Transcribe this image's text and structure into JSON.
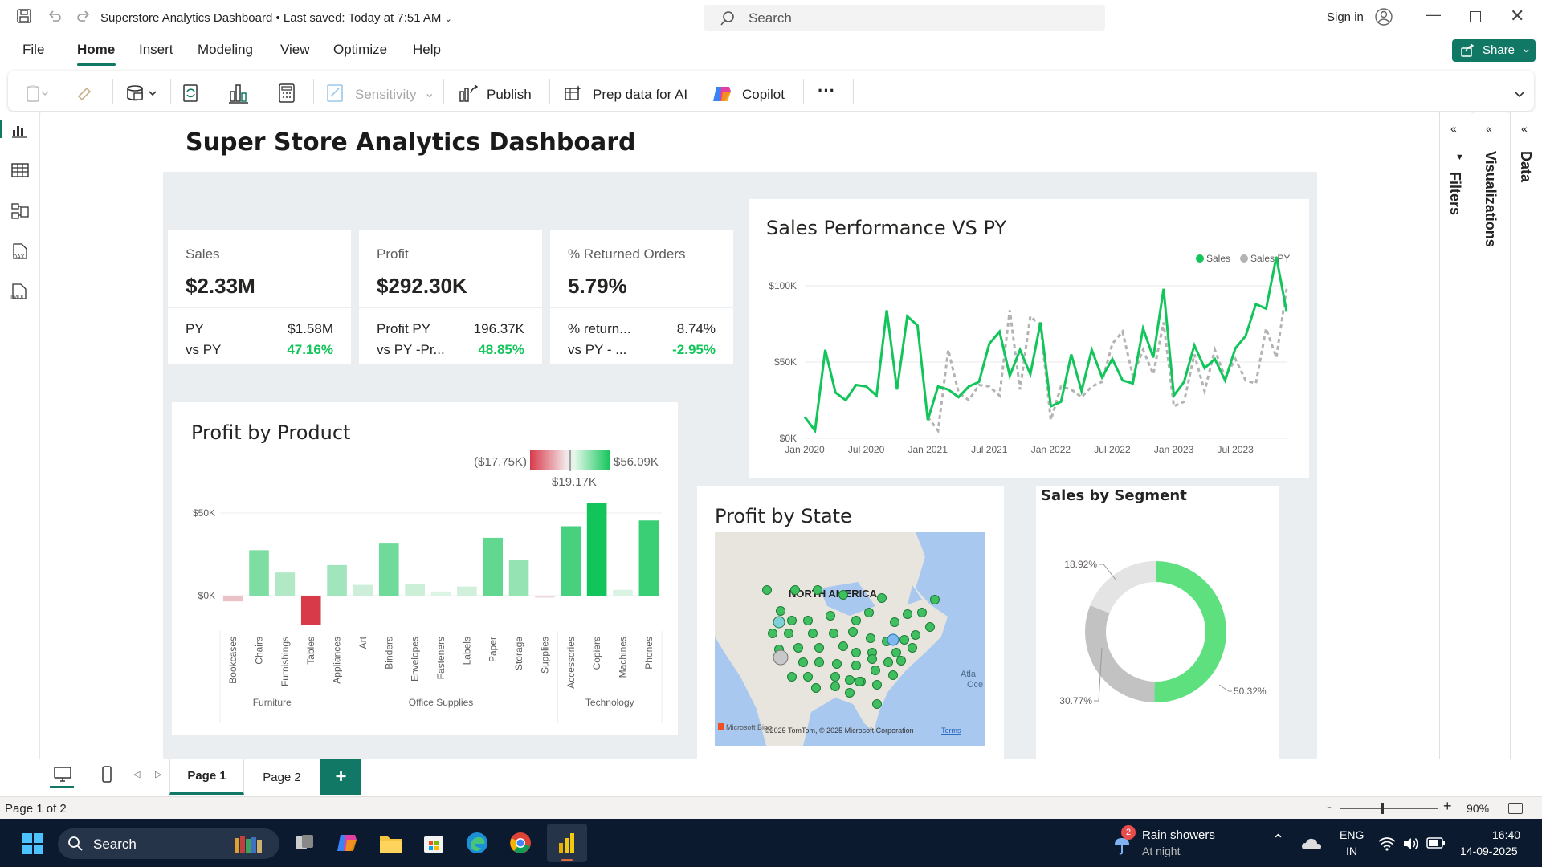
{
  "titlebar": {
    "doc_title": "Superstore Analytics Dashboard",
    "saved": "Last saved: Today at 7:51 AM",
    "search_placeholder": "Search",
    "sign_in": "Sign in"
  },
  "menu": [
    "File",
    "Home",
    "Insert",
    "Modeling",
    "View",
    "Optimize",
    "Help"
  ],
  "share_label": "Share",
  "ribbon": {
    "sensitivity": "Sensitivity",
    "publish": "Publish",
    "prep": "Prep data for AI",
    "copilot": "Copilot",
    "more": "···"
  },
  "report": {
    "title": "Super Store Analytics Dashboard",
    "kpis": [
      {
        "label": "Sales",
        "value": "$2.33M",
        "r1l": "PY",
        "r1v": "$1.58M",
        "r2l": "vs PY",
        "r2v": "47.16%"
      },
      {
        "label": "Profit",
        "value": "$292.30K",
        "r1l": "Profit PY",
        "r1v": "196.37K",
        "r2l": "vs PY -Pr...",
        "r2v": "48.85%"
      },
      {
        "label": "% Returned Orders",
        "value": "5.79%",
        "r1l": "% return...",
        "r1v": "8.74%",
        "r2l": "vs PY - ...",
        "r2v": "-2.95%"
      }
    ]
  },
  "line_chart_title": "Sales Performance VS PY",
  "bar_chart_title": "Profit by Product",
  "map_title": "Profit by State",
  "donut_title": "Sales by Segment",
  "gradient_legend": {
    "min": "($17.75K)",
    "max": "$56.09K",
    "mid": "$19.17K"
  },
  "map": {
    "label": "NORTH AMERICA",
    "attribution": "©2025 TomTom, © 2025 Microsoft Corporation",
    "terms": "Terms",
    "brand": "Microsoft Bing",
    "atlantic": "Atla\nOce"
  },
  "chart_data": [
    {
      "type": "line",
      "title": "Sales Performance VS PY",
      "legend": [
        "Sales",
        "Sales PY"
      ],
      "legend_position": "top-right",
      "x_ticks": [
        "Jan 2020",
        "Jul 2020",
        "Jan 2021",
        "Jul 2021",
        "Jan 2022",
        "Jul 2022",
        "Jan 2023",
        "Jul 2023"
      ],
      "y_ticks": [
        "$0K",
        "$50K",
        "$100K"
      ],
      "ylim": [
        0,
        120000
      ],
      "series": [
        {
          "name": "Sales",
          "color": "#12c55a",
          "values": [
            14000,
            5000,
            58000,
            30000,
            25000,
            35000,
            34000,
            28000,
            84000,
            32000,
            80000,
            74000,
            12000,
            34000,
            32000,
            27000,
            34000,
            37000,
            62000,
            70000,
            41000,
            58000,
            42000,
            76000,
            21000,
            24000,
            55000,
            31000,
            58000,
            40000,
            52000,
            38000,
            36000,
            72000,
            53000,
            98000,
            28000,
            37000,
            61000,
            46000,
            52000,
            38000,
            59000,
            67000,
            88000,
            85000,
            119000,
            83000
          ]
        },
        {
          "name": "Sales PY",
          "color": "#b3b3b3",
          "values": [
            null,
            null,
            null,
            null,
            null,
            null,
            null,
            null,
            null,
            null,
            null,
            null,
            14000,
            5000,
            58000,
            30000,
            25000,
            35000,
            34000,
            28000,
            84000,
            32000,
            80000,
            74000,
            12000,
            34000,
            32000,
            27000,
            34000,
            37000,
            62000,
            70000,
            41000,
            58000,
            42000,
            76000,
            21000,
            24000,
            55000,
            31000,
            58000,
            40000,
            52000,
            38000,
            36000,
            72000,
            53000,
            98000
          ]
        }
      ]
    },
    {
      "type": "bar",
      "title": "Profit by Product",
      "groups": [
        {
          "name": "Furniture",
          "categories": [
            "Bookcases",
            "Chairs",
            "Furnishings",
            "Tables"
          ]
        },
        {
          "name": "Office Supplies",
          "categories": [
            "Appliances",
            "Art",
            "Binders",
            "Envelopes",
            "Fasteners",
            "Labels",
            "Paper",
            "Storage",
            "Supplies"
          ]
        },
        {
          "name": "Technology",
          "categories": [
            "Accessories",
            "Copiers",
            "Machines",
            "Phones"
          ]
        }
      ],
      "categories": [
        "Bookcases",
        "Chairs",
        "Furnishings",
        "Tables",
        "Appliances",
        "Art",
        "Binders",
        "Envelopes",
        "Fasteners",
        "Labels",
        "Paper",
        "Storage",
        "Supplies",
        "Accessories",
        "Copiers",
        "Machines",
        "Phones"
      ],
      "values": [
        -3500,
        27500,
        14000,
        -17750,
        18500,
        6500,
        31500,
        7000,
        2500,
        5500,
        35000,
        21500,
        -1200,
        42000,
        56090,
        3500,
        45500
      ],
      "y_ticks": [
        "$0K",
        "$50K"
      ],
      "ylim": [
        -20000,
        60000
      ]
    },
    {
      "type": "pie",
      "title": "Sales by Segment",
      "labels": [
        "50.32%",
        "30.77%",
        "18.92%"
      ],
      "values": [
        50.32,
        30.77,
        18.92
      ],
      "colors": [
        "#5fe07f",
        "#c2c2c2",
        "#e4e4e4"
      ]
    }
  ],
  "panes": [
    "Filters",
    "Visualizations",
    "Data"
  ],
  "pages": {
    "tabs": [
      "Page 1",
      "Page 2"
    ],
    "add": "+"
  },
  "status": {
    "page": "Page 1 of 2",
    "zoom": "90%"
  },
  "taskbar": {
    "search": "Search",
    "weather": "Rain showers",
    "weather_sub": "At night",
    "badge": "2",
    "lang1": "ENG",
    "lang2": "IN",
    "time": "16:40",
    "date": "14-09-2025"
  }
}
